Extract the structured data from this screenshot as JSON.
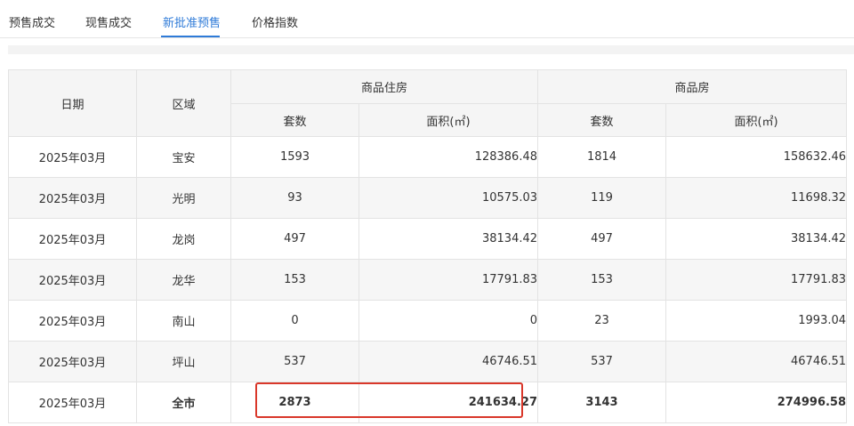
{
  "tabs": [
    {
      "label": "预售成交",
      "active": false
    },
    {
      "label": "现售成交",
      "active": false
    },
    {
      "label": "新批准预售",
      "active": true
    },
    {
      "label": "价格指数",
      "active": false
    }
  ],
  "accent_color": "#2f7bd8",
  "highlight_color": "#d9372a",
  "table": {
    "headers": {
      "date": "日期",
      "district": "区域",
      "group_residential": "商品住房",
      "group_all": "商品房",
      "units": "套数",
      "area": "面积(㎡)"
    },
    "rows": [
      {
        "date": "2025年03月",
        "district": "宝安",
        "res_units": "1593",
        "res_area": "128386.48",
        "all_units": "1814",
        "all_area": "158632.46"
      },
      {
        "date": "2025年03月",
        "district": "光明",
        "res_units": "93",
        "res_area": "10575.03",
        "all_units": "119",
        "all_area": "11698.32"
      },
      {
        "date": "2025年03月",
        "district": "龙岗",
        "res_units": "497",
        "res_area": "38134.42",
        "all_units": "497",
        "all_area": "38134.42"
      },
      {
        "date": "2025年03月",
        "district": "龙华",
        "res_units": "153",
        "res_area": "17791.83",
        "all_units": "153",
        "all_area": "17791.83"
      },
      {
        "date": "2025年03月",
        "district": "南山",
        "res_units": "0",
        "res_area": "0",
        "all_units": "23",
        "all_area": "1993.04"
      },
      {
        "date": "2025年03月",
        "district": "坪山",
        "res_units": "537",
        "res_area": "46746.51",
        "all_units": "537",
        "all_area": "46746.51"
      },
      {
        "date": "2025年03月",
        "district": "全市",
        "res_units": "2873",
        "res_area": "241634.27",
        "all_units": "3143",
        "all_area": "274996.58"
      }
    ]
  }
}
